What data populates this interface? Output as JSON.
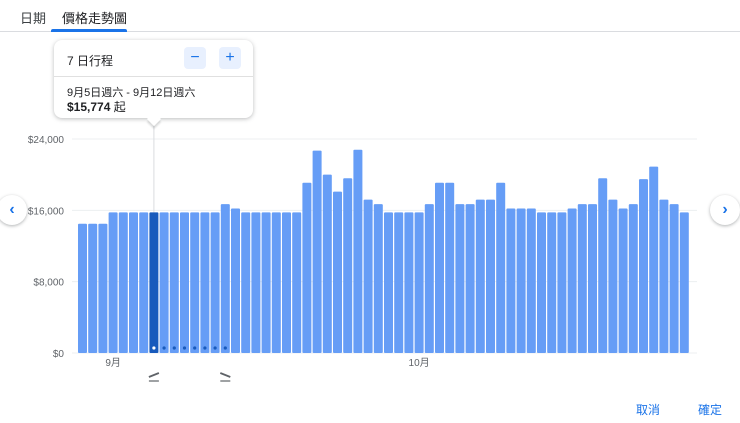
{
  "tabs": [
    {
      "label": "日期"
    },
    {
      "label": "價格走勢圖"
    }
  ],
  "tooltip": {
    "trip_length": "7 日行程",
    "minus": "−",
    "plus": "+",
    "dates": "9月5日週六 - 9月12日週六",
    "price": "$15,774",
    "price_suffix": "起"
  },
  "nav": {
    "prev": "‹",
    "next": "›"
  },
  "actions": {
    "cancel": "取消",
    "confirm": "確定"
  },
  "colors": {
    "bar": "#669df6",
    "selected": "#185abc",
    "accent": "#1a73e8"
  },
  "chart_data": {
    "type": "bar",
    "title": "",
    "xlabel": "",
    "ylabel": "",
    "ylim": [
      0,
      24000
    ],
    "yticks": [
      "$0",
      "$8,000",
      "$16,000",
      "$24,000"
    ],
    "ytick_values": [
      0,
      8000,
      16000,
      24000
    ],
    "month_labels": [
      {
        "label": "9月",
        "index": 3
      },
      {
        "label": "10月",
        "index": 33
      }
    ],
    "selected_index": 7,
    "trip_end_index": 14,
    "values": [
      14500,
      14500,
      14500,
      15774,
      15774,
      15774,
      15774,
      15774,
      15774,
      15774,
      15774,
      15774,
      15774,
      15774,
      16700,
      16200,
      15774,
      15774,
      15774,
      15774,
      15774,
      15774,
      19100,
      22700,
      20000,
      18100,
      19600,
      22800,
      17200,
      16700,
      15774,
      15774,
      15774,
      15774,
      16700,
      19100,
      19100,
      16700,
      16700,
      17200,
      17200,
      19100,
      16200,
      16200,
      16200,
      15774,
      15774,
      15774,
      16200,
      16700,
      16700,
      19600,
      17200,
      16200,
      16700,
      19500,
      20900,
      17200,
      16700,
      15774
    ]
  }
}
